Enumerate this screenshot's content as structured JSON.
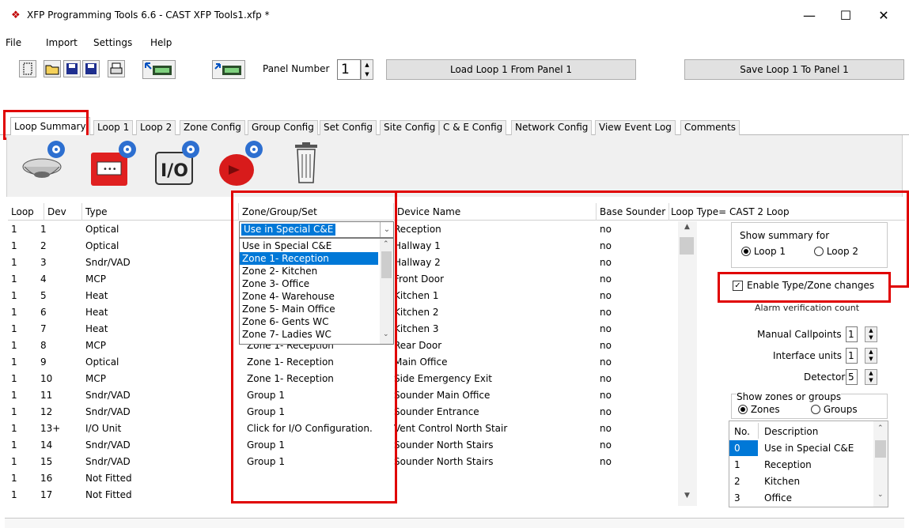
{
  "window": {
    "title": "XFP Programming Tools 6.6 - CAST XFP Tools1.xfp *",
    "minimize": "—",
    "maximize": "☐",
    "close": "✕"
  },
  "menu": [
    "File",
    "Import",
    "Settings",
    "Help"
  ],
  "toolbar": {
    "panel_number_label": "Panel Number",
    "panel_number_value": "1",
    "load_button": "Load Loop 1 From Panel 1",
    "save_button": "Save Loop 1 To Panel 1"
  },
  "tabs": [
    "Loop Summary",
    "Loop 1",
    "Loop 2",
    "Zone Config",
    "Group Config",
    "Set Config",
    "Site Config",
    "C & E Config",
    "Network Config",
    "View Event Log",
    "Comments"
  ],
  "panel_icons": [
    "detector-icon",
    "callpoint-icon",
    "io-unit-icon",
    "sounder-icon",
    "delete-bin-icon"
  ],
  "panel_icon_labels": {
    "io": "I/O"
  },
  "grid": {
    "headers": [
      "Loop",
      "Dev",
      "Type",
      "Zone/Group/Set",
      "Device Name",
      "Base Sounder"
    ],
    "rows": [
      {
        "loop": "1",
        "dev": "1",
        "type": "Optical",
        "zone": "",
        "name": "Reception",
        "base": "no"
      },
      {
        "loop": "1",
        "dev": "2",
        "type": "Optical",
        "zone": "",
        "name": "Hallway 1",
        "base": "no"
      },
      {
        "loop": "1",
        "dev": "3",
        "type": "Sndr/VAD",
        "zone": "",
        "name": "Hallway 2",
        "base": "no"
      },
      {
        "loop": "1",
        "dev": "4",
        "type": "MCP",
        "zone": "",
        "name": "Front Door",
        "base": "no"
      },
      {
        "loop": "1",
        "dev": "5",
        "type": "Heat",
        "zone": "",
        "name": "Kitchen 1",
        "base": "no"
      },
      {
        "loop": "1",
        "dev": "6",
        "type": "Heat",
        "zone": "",
        "name": "Kitchen 2",
        "base": "no"
      },
      {
        "loop": "1",
        "dev": "7",
        "type": "Heat",
        "zone": "",
        "name": "Kitchen 3",
        "base": "no"
      },
      {
        "loop": "1",
        "dev": "8",
        "type": "MCP",
        "zone": "Zone 1- Reception",
        "name": "Rear Door",
        "base": "no"
      },
      {
        "loop": "1",
        "dev": "9",
        "type": "Optical",
        "zone": "Zone 1- Reception",
        "name": "Main Office",
        "base": "no"
      },
      {
        "loop": "1",
        "dev": "10",
        "type": "MCP",
        "zone": "Zone 1- Reception",
        "name": "Side Emergency Exit",
        "base": "no"
      },
      {
        "loop": "1",
        "dev": "11",
        "type": "Sndr/VAD",
        "zone": "Group 1",
        "name": "Sounder Main Office",
        "base": "no"
      },
      {
        "loop": "1",
        "dev": "12",
        "type": "Sndr/VAD",
        "zone": "Group 1",
        "name": "Sounder Entrance",
        "base": "no"
      },
      {
        "loop": "1",
        "dev": "13+",
        "type": "I/O Unit",
        "zone": "Click for I/O Configuration.",
        "name": "Vent Control North Stair",
        "base": "no"
      },
      {
        "loop": "1",
        "dev": "14",
        "type": "Sndr/VAD",
        "zone": "Group 1",
        "name": "Sounder North Stairs",
        "base": "no"
      },
      {
        "loop": "1",
        "dev": "15",
        "type": "Sndr/VAD",
        "zone": "Group 1",
        "name": "Sounder North Stairs",
        "base": "no"
      },
      {
        "loop": "1",
        "dev": "16",
        "type": "Not Fitted",
        "zone": "",
        "name": "",
        "base": ""
      },
      {
        "loop": "1",
        "dev": "17",
        "type": "Not Fitted",
        "zone": "",
        "name": "",
        "base": ""
      }
    ]
  },
  "dropdown": {
    "selected": "Use in Special C&E",
    "options": [
      "Use in Special C&E",
      "Zone 1- Reception",
      "Zone 2- Kitchen",
      "Zone 3- Office",
      "Zone 4- Warehouse",
      "Zone 5- Main Office",
      "Zone 6- Gents WC",
      "Zone 7- Ladies WC"
    ],
    "highlighted_index": 1
  },
  "right_panel": {
    "loop_type": "Loop Type=  CAST 2 Loop",
    "show_summary_for": "Show summary for",
    "loop1": "Loop 1",
    "loop2": "Loop 2",
    "enable_changes": "Enable Type/Zone changes",
    "alarm_verification": "Alarm verification count",
    "manual_callpoints_label": "Manual Callpoints",
    "manual_callpoints_value": "1",
    "interface_units_label": "Interface units",
    "interface_units_value": "1",
    "detectors_label": "Detectors",
    "detectors_value": "5",
    "show_zones_groups": "Show zones or groups",
    "zones": "Zones",
    "groups": "Groups",
    "table_headers": [
      "No.",
      "Description"
    ],
    "table_rows": [
      {
        "no": "0",
        "desc": "Use in Special C&E"
      },
      {
        "no": "1",
        "desc": "Reception"
      },
      {
        "no": "2",
        "desc": "Kitchen"
      },
      {
        "no": "3",
        "desc": "Office"
      }
    ]
  },
  "colors": {
    "highlight": "#0078d7",
    "annotation_red": "#e00000"
  }
}
